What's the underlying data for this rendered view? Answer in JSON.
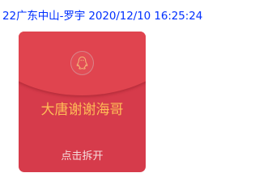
{
  "message": {
    "sender": "22广东中山-罗宇",
    "timestamp": "2020/12/10 16:25:24"
  },
  "red_packet": {
    "title": "大唐谢谢海哥",
    "open_label": "点击拆开",
    "seal_icon": "qq-penguin-icon",
    "colors": {
      "body": "#d63b4b",
      "flap": "#e0444f",
      "title_text": "#ffbd57",
      "seal_line": "#d8848a"
    }
  },
  "colors": {
    "header_text": "#0030ff",
    "background": "#ffffff"
  }
}
